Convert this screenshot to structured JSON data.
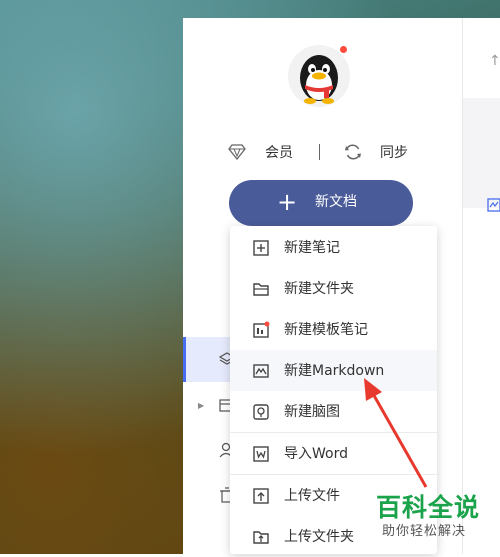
{
  "user": {
    "vip_label": "会员",
    "sync_label": "同步"
  },
  "toolbar": {
    "new_doc_label": "新文档"
  },
  "menu": {
    "items": [
      {
        "label": "新建笔记",
        "icon": "new-note-icon"
      },
      {
        "label": "新建文件夹",
        "icon": "folder-icon"
      },
      {
        "label": "新建模板笔记",
        "icon": "template-icon"
      },
      {
        "label": "新建Markdown",
        "icon": "markdown-icon"
      },
      {
        "label": "新建脑图",
        "icon": "mindmap-icon"
      },
      {
        "label": "导入Word",
        "icon": "word-import-icon"
      },
      {
        "label": "上传文件",
        "icon": "upload-file-icon"
      },
      {
        "label": "上传文件夹",
        "icon": "upload-folder-icon"
      }
    ]
  },
  "watermark": {
    "title": "百科全说",
    "subtitle": "助你轻松解决"
  },
  "colors": {
    "accent": "#4a5b9a",
    "selection": "#e5eafc",
    "annotation_arrow": "#e8392e",
    "watermark": "#1aa34a"
  }
}
